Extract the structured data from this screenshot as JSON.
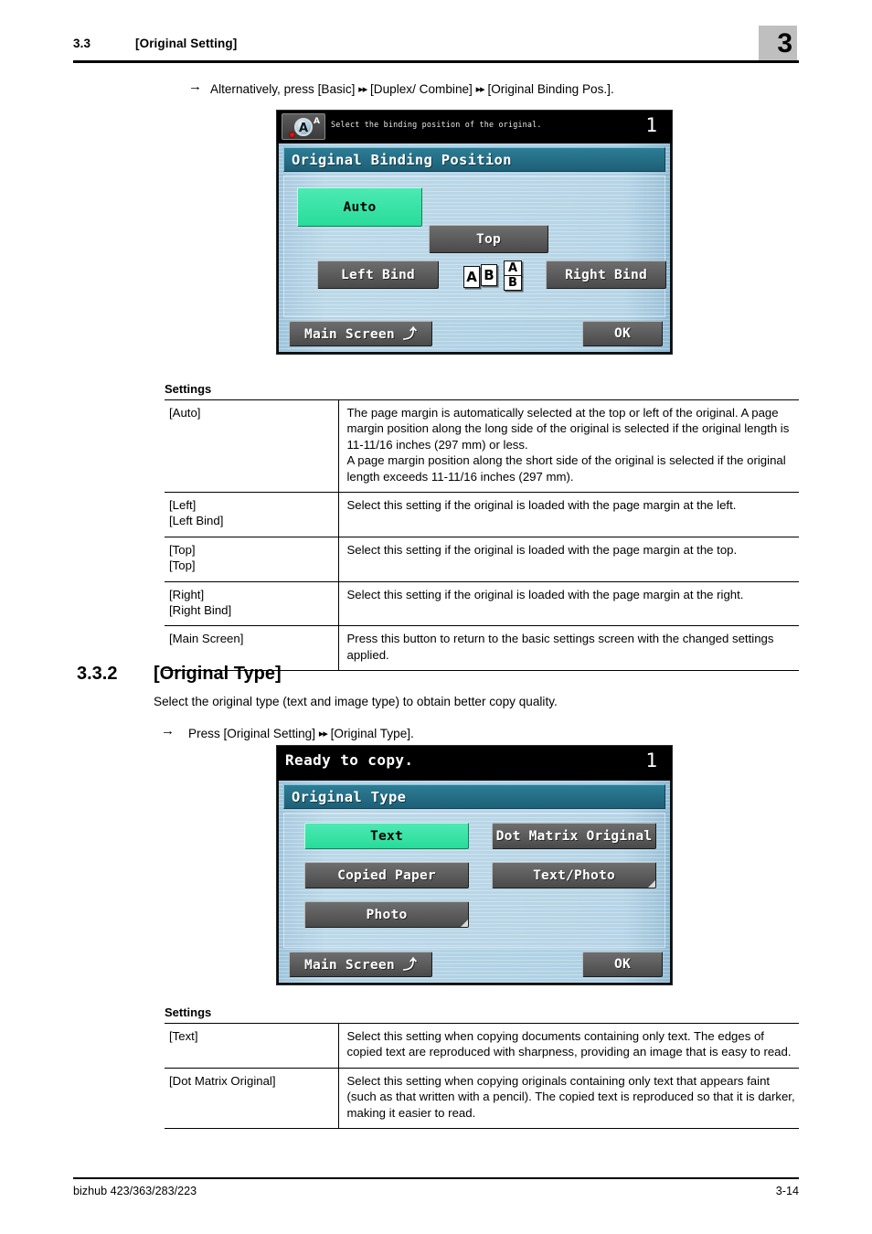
{
  "header": {
    "section_number": "3.3",
    "section_title": "[Original Setting]",
    "chapter_badge": "3"
  },
  "intro_step": {
    "arrow": "→",
    "text_before": "Alternatively, press [Basic]",
    "dbl_arrow_1": "▸▸",
    "text_middle": "[Duplex/ Combine]",
    "dbl_arrow_2": "▸▸",
    "text_after": "[Original Binding Pos.]."
  },
  "lcd_binding": {
    "status_message": "Select the binding position of the original.",
    "copy_count": "1",
    "icon_name": "original-scan-icon",
    "icon_letter": "A",
    "icon_superscript": "A",
    "title": "Original Binding Position",
    "buttons": {
      "auto": "Auto",
      "top": "Top",
      "left_bind": "Left Bind",
      "right_bind": "Right Bind",
      "main_screen": "Main Screen",
      "main_screen_glyph": "⤴",
      "ok": "OK"
    },
    "selected": "Auto",
    "diagram": {
      "sheet1": "A",
      "sheet2": "B",
      "sheet3_top": "A",
      "sheet3_bottom": "B"
    },
    "colors": {
      "selected_button": "#28dc9a",
      "button": "#5a5a5a",
      "title_bar": "#24708a",
      "screen_bg": "#aed0e4"
    }
  },
  "settings_table_1": {
    "label": "Settings",
    "rows": [
      {
        "key": "[Auto]",
        "value": "The page margin is automatically selected at the top or left of the original. A page margin position along the long side of the original is selected if the original length is 11-11/16 inches (297 mm) or less.\nA page margin position along the short side of the original is selected if the original length exceeds 11-11/16 inches (297 mm)."
      },
      {
        "key": "[Left]\n[Left Bind]",
        "value": "Select this setting if the original is loaded with the page margin at the left."
      },
      {
        "key": "[Top]\n[Top]",
        "value": "Select this setting if the original is loaded with the page margin at the top."
      },
      {
        "key": "[Right]\n[Right Bind]",
        "value": "Select this setting if the original is loaded with the page margin at the right."
      },
      {
        "key": "[Main Screen]",
        "value": "Press this button to return to the basic settings screen with the changed settings applied."
      }
    ]
  },
  "section_332": {
    "number": "3.3.2",
    "title": "[Original Type]",
    "description": "Select the original type (text and image type) to obtain better copy quality.",
    "step": {
      "arrow": "→",
      "text_before": "Press [Original Setting]",
      "dbl_arrow": "▸▸",
      "text_after": "[Original Type]."
    }
  },
  "lcd_original_type": {
    "status_message": "Ready to copy.",
    "copy_count": "1",
    "title": "Original Type",
    "buttons": {
      "text": "Text",
      "dot_matrix": "Dot Matrix Original",
      "copied_paper": "Copied Paper",
      "text_photo": "Text/Photo",
      "photo": "Photo",
      "main_screen": "Main Screen",
      "main_screen_glyph": "⤴",
      "ok": "OK"
    },
    "selected": "Text",
    "submenu_buttons": [
      "Text/Photo",
      "Photo"
    ]
  },
  "settings_table_2": {
    "label": "Settings",
    "rows": [
      {
        "key": "[Text]",
        "value": "Select this setting when copying documents containing only text. The edges of copied text are reproduced with sharpness, providing an image that is easy to read."
      },
      {
        "key": "[Dot Matrix Original]",
        "value": "Select this setting when copying originals containing only text that appears faint (such as that written with a pencil). The copied text is reproduced so that it is darker, making it easier to read."
      }
    ]
  },
  "footer": {
    "model": "bizhub 423/363/283/223",
    "page_number": "3-14"
  }
}
